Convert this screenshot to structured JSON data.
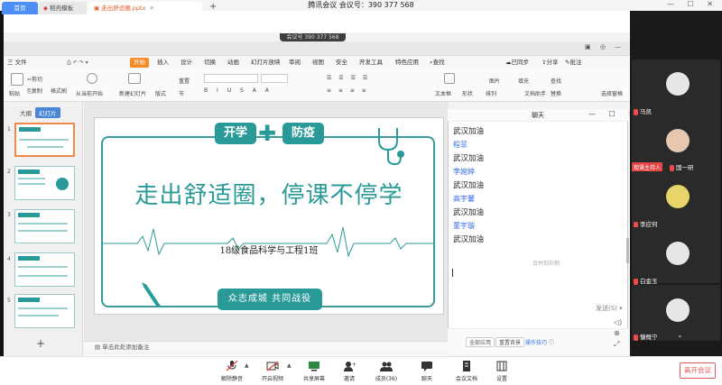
{
  "meeting": {
    "title": "腾讯会议 会议号：390 377 568",
    "share_badge": "会议号 390 377 568",
    "leave_label": "离开会议"
  },
  "wps": {
    "tabs": [
      {
        "label": "首页"
      },
      {
        "label": "稻壳模板"
      },
      {
        "label": "走出舒适圈.pptx"
      }
    ],
    "menu": [
      "三 文件",
      "开始",
      "插入",
      "设计",
      "切换",
      "动画",
      "幻灯片放映",
      "审阅",
      "视图",
      "安全",
      "开发工具",
      "特色应用",
      "查找"
    ],
    "menu_right": [
      "已同步",
      "分享",
      "批注"
    ],
    "ribbon": {
      "paste": "粘贴",
      "cut": "剪切",
      "copy": "复制",
      "format_painter": "格式刷",
      "from_start": "从当前开始",
      "new_slide": "新建幻灯片",
      "layout": "版式",
      "reset": "重置",
      "section": "节",
      "textbox": "文本框",
      "shape": "形状",
      "arrange": "排列",
      "picture": "图片",
      "fill": "填充",
      "find": "查找",
      "replace": "替换",
      "text_assistant": "文档助手",
      "select_pane": "选择窗格"
    },
    "sidebar": {
      "outline": "大纲",
      "slides": "幻灯片",
      "thumb_numbers": [
        "1",
        "2",
        "3",
        "4",
        "5"
      ]
    },
    "notes_placeholder": "单击此处添加备注"
  },
  "slide": {
    "pill_left": "开学",
    "plus": "✚",
    "pill_right": "防疫",
    "title": "走出舒适圈，停课不停学",
    "subtitle": "18级食品科学与工程1班",
    "bottom": "众志成城  共同战役"
  },
  "chat": {
    "title": "聊天",
    "messages": [
      {
        "sender": "",
        "text": "武汉加油"
      },
      {
        "sender": "程菲",
        "text": "武汉加油"
      },
      {
        "sender": "李婉婷",
        "text": "武汉加油"
      },
      {
        "sender": "高宇馨",
        "text": "武汉加油"
      },
      {
        "sender": "董宇璇",
        "text": "武汉加油"
      }
    ],
    "hint": "合并到右侧",
    "send": "发送(S)",
    "bottom_btns": [
      "全部应用",
      "重置背景"
    ],
    "help": "操作技巧"
  },
  "participants": [
    {
      "name": "马凯"
    },
    {
      "name": "国一研",
      "host_badge": "观课主持人"
    },
    {
      "name": "李应何"
    },
    {
      "name": "白金玉"
    },
    {
      "name": "慷慨宁"
    }
  ],
  "toolbar": [
    {
      "label": "解除静音",
      "icon": "mic-muted-icon"
    },
    {
      "label": "开启视频",
      "icon": "video-off-icon"
    },
    {
      "label": "共享屏幕",
      "icon": "screen-share-icon"
    },
    {
      "label": "邀请",
      "icon": "invite-icon"
    },
    {
      "label": "成员(36)",
      "icon": "members-icon"
    },
    {
      "label": "聊天",
      "icon": "chat-icon"
    },
    {
      "label": "会议文档",
      "icon": "document-icon"
    },
    {
      "label": "设置",
      "icon": "settings-icon"
    }
  ],
  "colors": {
    "teal": "#2a9a98",
    "wps_blue": "#4d8ff5",
    "wps_orange": "#f58b26",
    "leave_red": "#e25a5a"
  }
}
